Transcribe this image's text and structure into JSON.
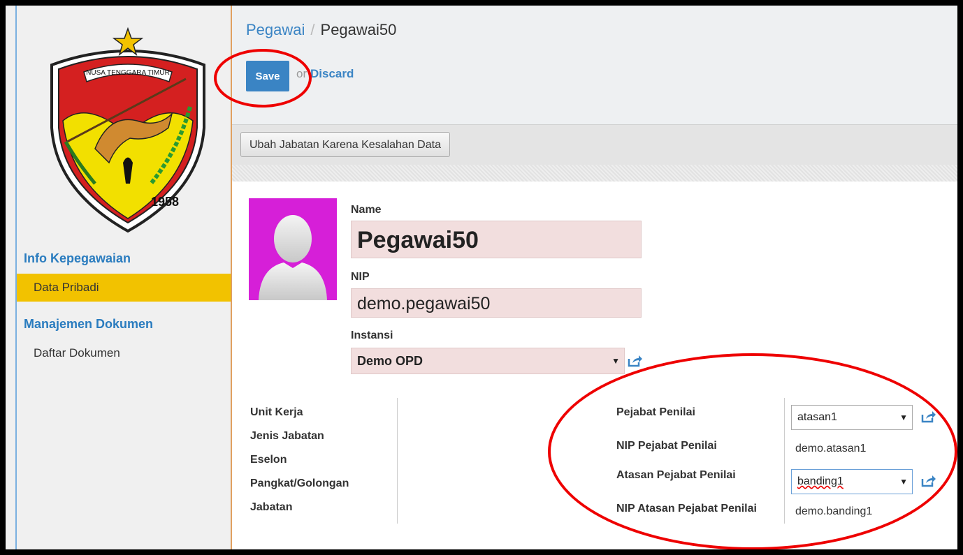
{
  "sidebar": {
    "logo": {
      "banner": "NUSA TENGGARA TIMUR",
      "year": "1958"
    },
    "sections": [
      {
        "title": "Info Kepegawaian",
        "items": [
          {
            "label": "Data Pribadi",
            "active": true
          }
        ]
      },
      {
        "title": "Manajemen Dokumen",
        "items": [
          {
            "label": "Daftar Dokumen",
            "active": false
          }
        ]
      }
    ]
  },
  "header": {
    "breadcrumb_parent": "Pegawai",
    "breadcrumb_sep": "/",
    "breadcrumb_current": "Pegawai50",
    "save_label": "Save",
    "or_label": "or",
    "discard_label": "Discard"
  },
  "toolbar": {
    "ubah_label": "Ubah Jabatan Karena Kesalahan Data"
  },
  "form": {
    "name_label": "Name",
    "name_value": "Pegawai50",
    "nip_label": "NIP",
    "nip_value": "demo.pegawai50",
    "instansi_label": "Instansi",
    "instansi_value": "Demo OPD",
    "left_labels": [
      "Unit Kerja",
      "Jenis Jabatan",
      "Eselon",
      "Pangkat/Golongan",
      "Jabatan"
    ],
    "pejabat_penilai_label": "Pejabat Penilai",
    "pejabat_penilai_value": "atasan1",
    "nip_pejabat_label": "NIP Pejabat Penilai",
    "nip_pejabat_value": "demo.atasan1",
    "atasan_label": "Atasan Pejabat Penilai",
    "atasan_value": "banding1",
    "nip_atasan_label": "NIP Atasan Pejabat Penilai",
    "nip_atasan_value": "demo.banding1"
  },
  "colors": {
    "accent": "#3a84c4",
    "active_item": "#f2c200",
    "avatar_bg": "#d61fd8",
    "annotation": "#e00000"
  }
}
